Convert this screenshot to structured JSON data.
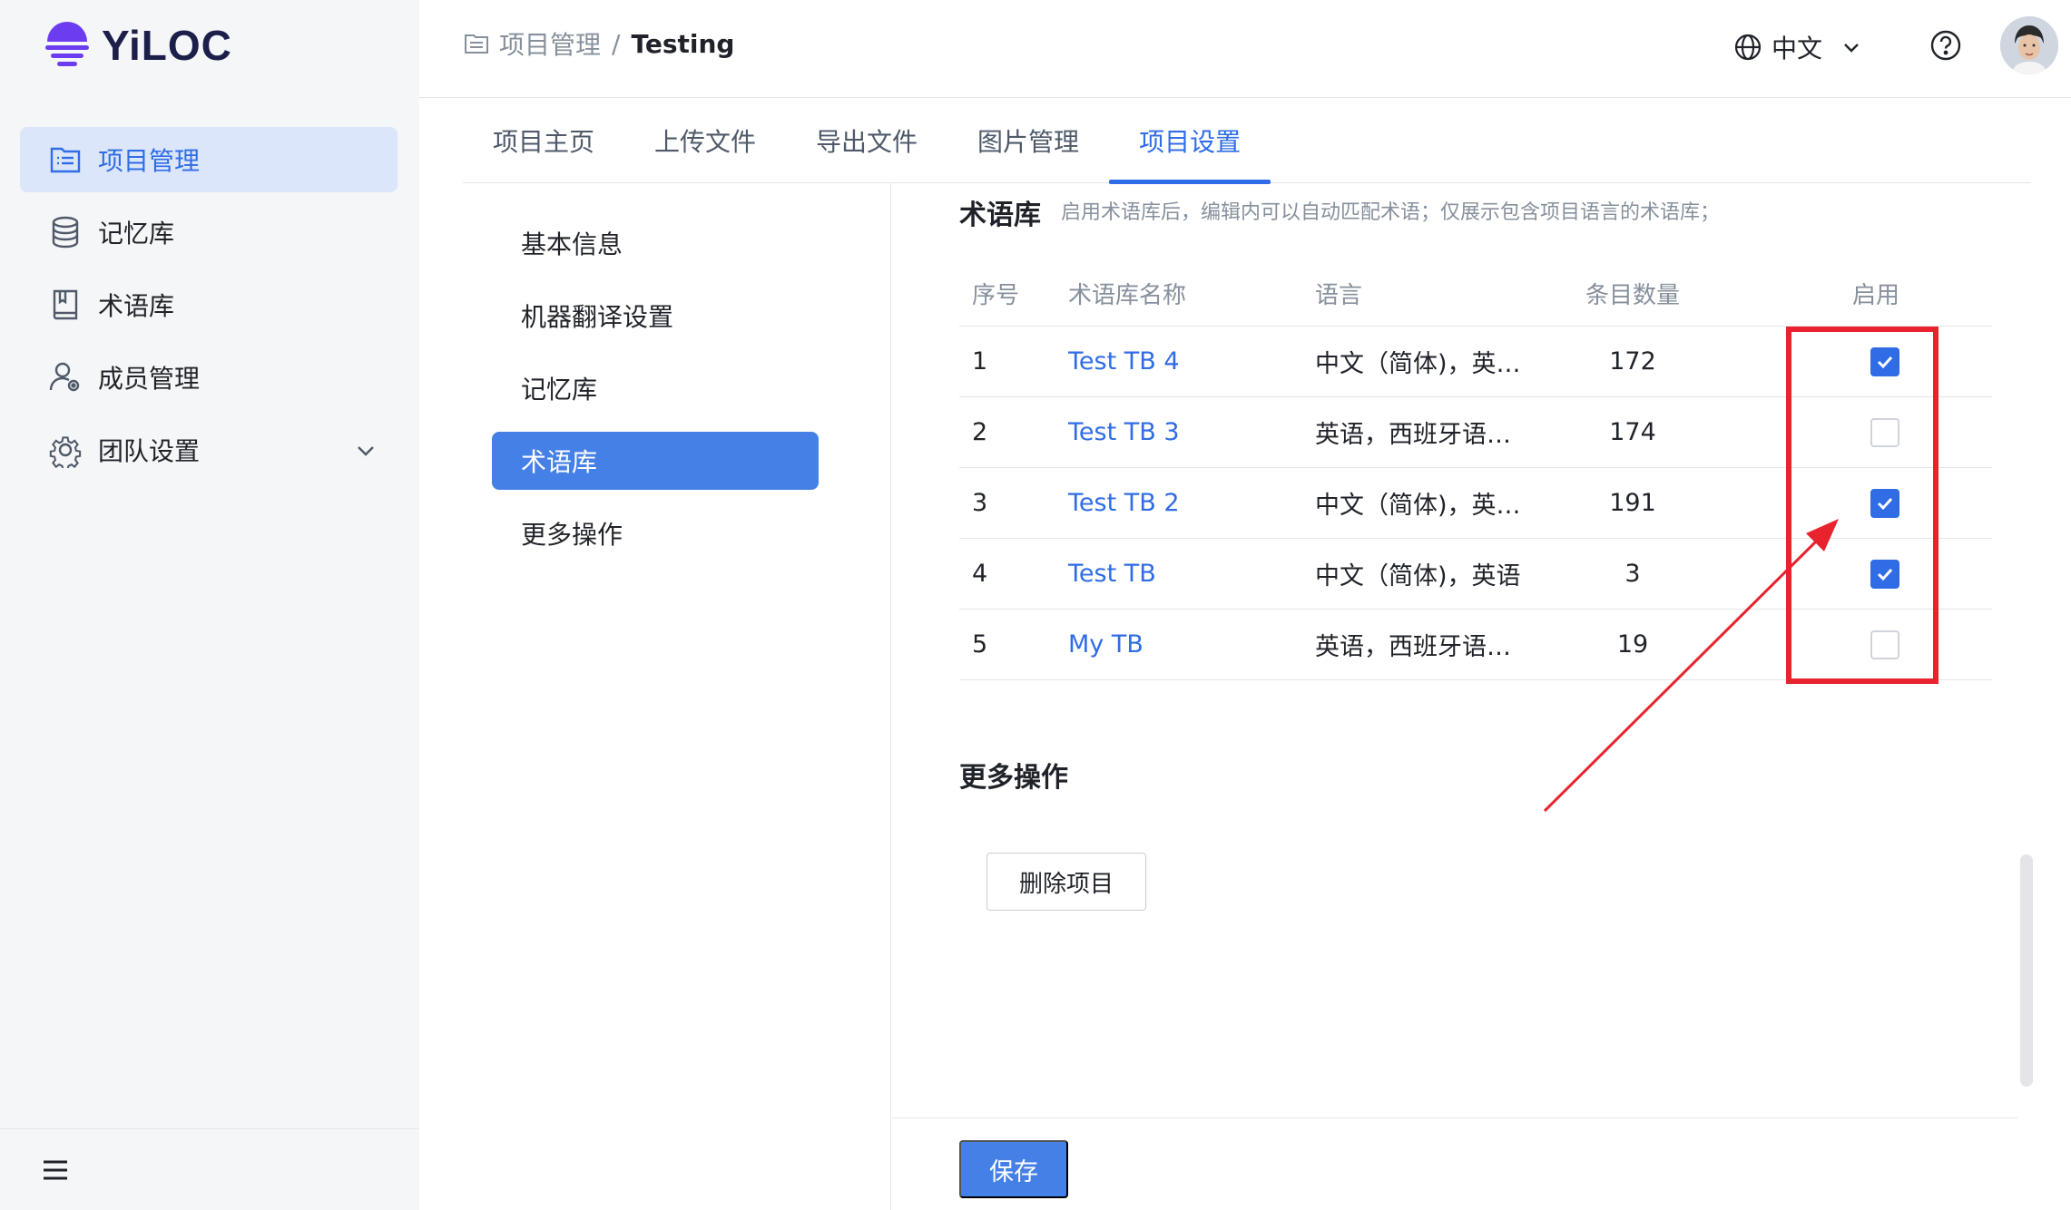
{
  "brand": {
    "name": "YiLOC"
  },
  "sidebar": {
    "items": [
      {
        "label": "项目管理",
        "icon": "project-list-icon"
      },
      {
        "label": "记忆库",
        "icon": "database-icon"
      },
      {
        "label": "术语库",
        "icon": "book-icon"
      },
      {
        "label": "成员管理",
        "icon": "user-settings-icon"
      },
      {
        "label": "团队设置",
        "icon": "gear-icon"
      }
    ],
    "active_index": 0,
    "footer_icon": "menu-icon"
  },
  "breadcrumb": {
    "parent": "项目管理",
    "separator": "/",
    "current": "Testing"
  },
  "header": {
    "language": "中文"
  },
  "tabs": [
    {
      "label": "项目主页"
    },
    {
      "label": "上传文件"
    },
    {
      "label": "导出文件"
    },
    {
      "label": "图片管理"
    },
    {
      "label": "项目设置"
    }
  ],
  "active_tab": 4,
  "subnav": [
    {
      "label": "基本信息"
    },
    {
      "label": "机器翻译设置"
    },
    {
      "label": "记忆库"
    },
    {
      "label": "术语库"
    },
    {
      "label": "更多操作"
    }
  ],
  "active_subnav": 3,
  "termbase": {
    "title": "术语库",
    "hint": "启用术语库后，编辑内可以自动匹配术语；仅展示包含项目语言的术语库；",
    "columns": {
      "index": "序号",
      "name": "术语库名称",
      "language": "语言",
      "count": "条目数量",
      "enabled": "启用"
    },
    "rows": [
      {
        "index": "1",
        "name": "Test TB 4",
        "language": "中文（简体)，英…",
        "count": "172",
        "enabled": true
      },
      {
        "index": "2",
        "name": "Test TB 3",
        "language": "英语，西班牙语…",
        "count": "174",
        "enabled": false
      },
      {
        "index": "3",
        "name": "Test TB 2",
        "language": "中文（简体)，英…",
        "count": "191",
        "enabled": true
      },
      {
        "index": "4",
        "name": "Test TB",
        "language": "中文（简体)，英语",
        "count": "3",
        "enabled": true
      },
      {
        "index": "5",
        "name": "My TB",
        "language": "英语，西班牙语…",
        "count": "19",
        "enabled": false
      }
    ]
  },
  "more_actions": {
    "title": "更多操作",
    "delete_label": "删除项目"
  },
  "footer": {
    "save_label": "保存"
  },
  "colors": {
    "accent": "#2f6ce5",
    "annotation": "#e8232d"
  }
}
